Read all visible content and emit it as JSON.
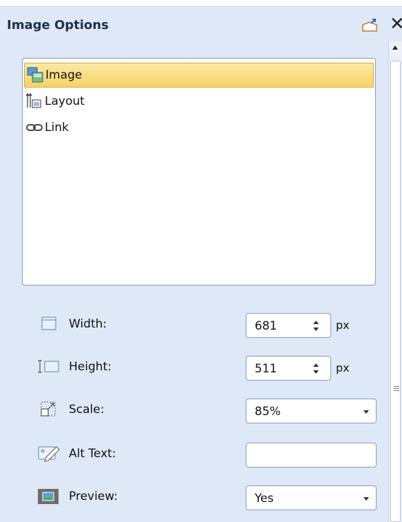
{
  "pane": {
    "title": "Image Options"
  },
  "list": {
    "items": [
      {
        "label": "Image",
        "icon": "image-icon",
        "selected": true
      },
      {
        "label": "Layout",
        "icon": "layout-icon",
        "selected": false
      },
      {
        "label": "Link",
        "icon": "link-icon",
        "selected": false
      }
    ]
  },
  "props": {
    "width": {
      "label": "Width:",
      "value": "681",
      "unit": "px",
      "icon": "width-icon"
    },
    "height": {
      "label": "Height:",
      "value": "511",
      "unit": "px",
      "icon": "height-icon"
    },
    "scale": {
      "label": "Scale:",
      "value": "85%",
      "icon": "scale-icon"
    },
    "alt": {
      "label": "Alt Text:",
      "value": "",
      "icon": "alt-text-icon"
    },
    "preview": {
      "label": "Preview:",
      "value": "Yes",
      "icon": "preview-icon"
    }
  },
  "colors": {
    "pane_bg": "#dfe8f6",
    "title": "#1e2f4e",
    "selection": "#f7d367",
    "border": "#7f9db9"
  }
}
